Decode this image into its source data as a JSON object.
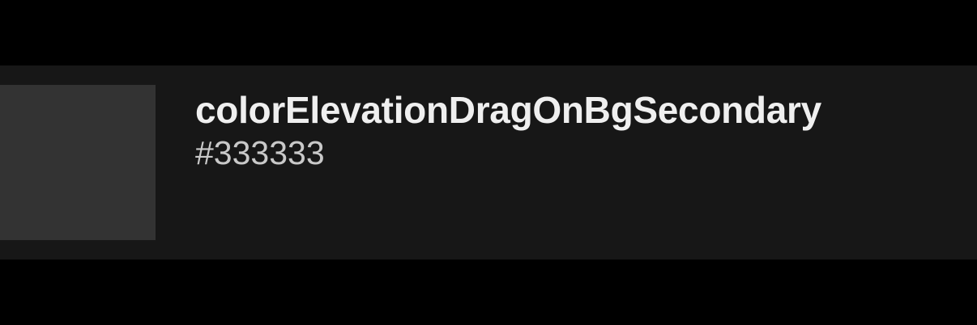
{
  "token": {
    "name": "colorElevationDragOnBgSecondary",
    "value": "#333333"
  },
  "colors": {
    "page_background": "#000000",
    "row_background": "#171717",
    "swatch": "#333333",
    "name_text": "#efefef",
    "value_text": "#c9c9c9"
  }
}
